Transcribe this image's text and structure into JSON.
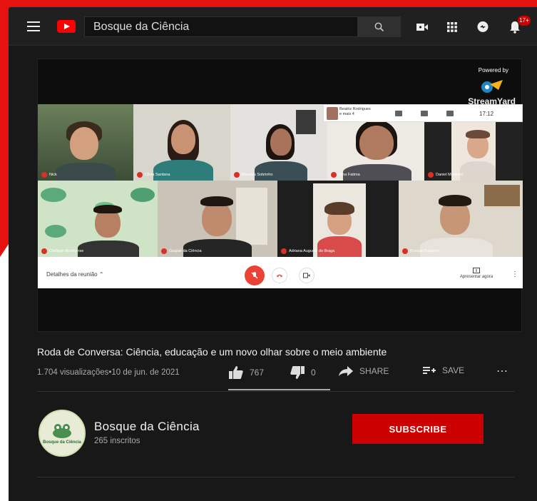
{
  "header": {
    "search_value": "Bosque da Ciência",
    "notification_count": "17+"
  },
  "video": {
    "powered_by": "Powered by",
    "brand": "StreamYard",
    "meet": {
      "overlay_name": "Beatriz Rodrigues",
      "overlay_sub": "e mais 4",
      "time": "17:12",
      "details_label": "Detalhes da reunião",
      "present_label": "Apresentar agora",
      "participants": [
        "Nick",
        "Clivia Santana",
        "Mariana Sobrinho",
        "Nina Fatima",
        "Daniel Monteiro",
        "Cleiligan Biodiverse",
        "Gaspar da Ciência",
        "Adriana Augusto do Braga",
        "Bosque Baixinho"
      ]
    }
  },
  "info": {
    "title": "Roda de Conversa: Ciência, educação e um novo olhar sobre o meio ambiente",
    "views": "1.704 visualizações",
    "date": "10 de jun. de 2021",
    "likes": "767",
    "dislikes": "0",
    "share_label": "SHARE",
    "save_label": "SAVE",
    "like_ratio": 1.0
  },
  "channel": {
    "name": "Bosque da Ciência",
    "subscribers": "265 inscritos",
    "avatar_text": "Bosque da Ciência",
    "subscribe_label": "SUBSCRIBE"
  },
  "colors": {
    "frame": "#e5120f",
    "subscribe": "#cc0000",
    "youtube_red": "#ff0000"
  }
}
